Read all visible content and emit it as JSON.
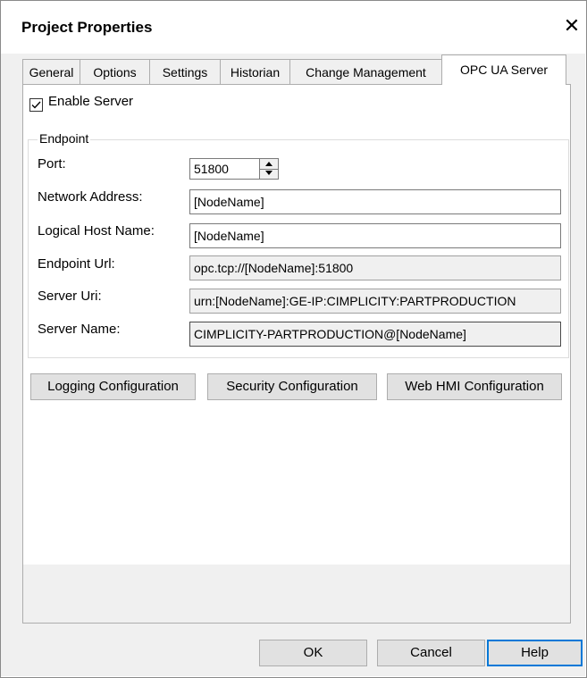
{
  "window": {
    "title": "Project Properties",
    "close_glyph": "✕"
  },
  "tabs": [
    {
      "label": "General"
    },
    {
      "label": "Options"
    },
    {
      "label": "Settings"
    },
    {
      "label": "Historian"
    },
    {
      "label": "Change Management"
    },
    {
      "label": "OPC UA Server",
      "active": true
    }
  ],
  "enable_server": {
    "label": "Enable Server",
    "checked": true
  },
  "endpoint": {
    "legend": "Endpoint",
    "port": {
      "label": "Port:",
      "value": "51800"
    },
    "network_address": {
      "label": "Network Address:",
      "value": "[NodeName]"
    },
    "logical_host": {
      "label": "Logical Host Name:",
      "value": "[NodeName]"
    },
    "endpoint_url": {
      "label": "Endpoint Url:",
      "value": "opc.tcp://[NodeName]:51800"
    },
    "server_uri": {
      "label": "Server Uri:",
      "value": "urn:[NodeName]:GE-IP:CIMPLICITY:PARTPRODUCTION"
    },
    "server_name": {
      "label": "Server Name:",
      "value": "CIMPLICITY-PARTPRODUCTION@[NodeName]"
    }
  },
  "config_buttons": {
    "logging": "Logging Configuration",
    "security": "Security Configuration",
    "webhmi": "Web HMI Configuration"
  },
  "footer": {
    "ok": "OK",
    "cancel": "Cancel",
    "help": "Help"
  },
  "colors": {
    "accent": "#0078d7",
    "dialog_bg": "#f0f0f0",
    "button_bg": "#e1e1e1"
  }
}
